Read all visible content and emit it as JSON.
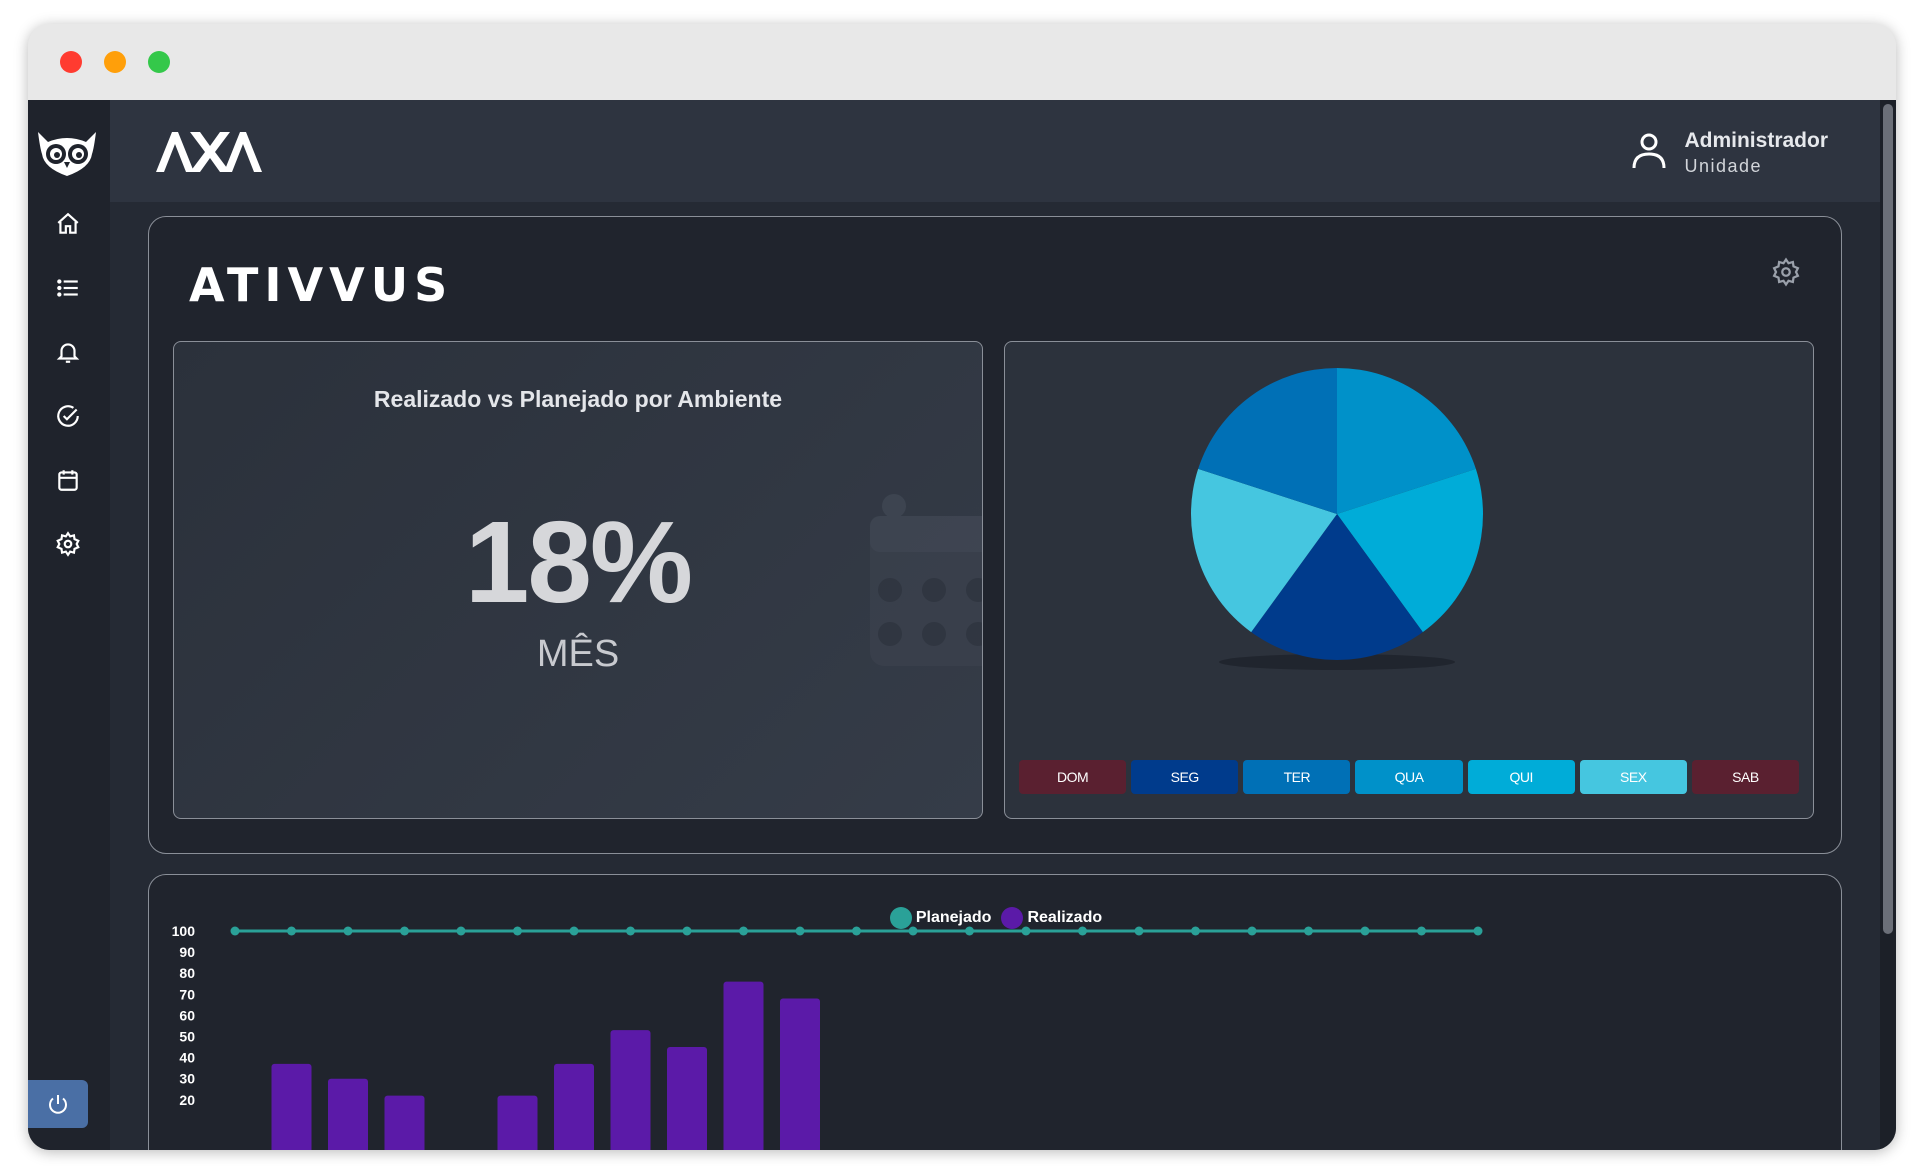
{
  "header": {
    "user_name": "Administrador",
    "user_role": "Unidade"
  },
  "sidebar": {
    "items": [
      {
        "icon": "home-icon"
      },
      {
        "icon": "list-icon"
      },
      {
        "icon": "bell-icon"
      },
      {
        "icon": "check-circle-icon"
      },
      {
        "icon": "calendar-icon"
      },
      {
        "icon": "gear-icon"
      }
    ]
  },
  "panel": {
    "title": "ATIVVUS"
  },
  "kpi": {
    "title": "Realizado vs Planejado por Ambiente",
    "value": "18%",
    "unit": "MÊS"
  },
  "days": [
    {
      "label": "DOM",
      "color": "#5a2030"
    },
    {
      "label": "SEG",
      "color": "#003b8c"
    },
    {
      "label": "TER",
      "color": "#0070b6"
    },
    {
      "label": "QUA",
      "color": "#0091c9"
    },
    {
      "label": "QUI",
      "color": "#00acd8"
    },
    {
      "label": "SEX",
      "color": "#45c6e0"
    },
    {
      "label": "SAB",
      "color": "#5a2030"
    }
  ],
  "chart_data": [
    {
      "type": "pie",
      "slices": [
        {
          "category": "SEG",
          "value": 20,
          "color": "#003b8c"
        },
        {
          "category": "TER",
          "value": 20,
          "color": "#0070b6"
        },
        {
          "category": "QUA",
          "value": 20,
          "color": "#0091c9"
        },
        {
          "category": "QUI",
          "value": 20,
          "color": "#00acd8"
        },
        {
          "category": "SEX",
          "value": 20,
          "color": "#45c6e0"
        }
      ]
    },
    {
      "type": "bar",
      "legend": [
        "Planejado",
        "Realizado"
      ],
      "yticks": [
        100,
        90,
        80,
        70,
        60,
        50,
        40,
        30,
        20
      ],
      "ylim": [
        20,
        100
      ],
      "series": [
        {
          "name": "Planejado",
          "type": "line",
          "color": "#2aa198",
          "values": [
            100,
            100,
            100,
            100,
            100,
            100,
            100,
            100,
            100,
            100,
            100,
            100,
            100,
            100,
            100,
            100,
            100,
            100,
            100,
            100,
            100,
            100,
            100
          ]
        },
        {
          "name": "Realizado",
          "type": "bar",
          "color": "#5b1aa8",
          "values": [
            0,
            37,
            30,
            22,
            0,
            22,
            37,
            53,
            45,
            76,
            68,
            0,
            0,
            0,
            0,
            0,
            0,
            0,
            0,
            0,
            0,
            0,
            0
          ]
        }
      ]
    }
  ]
}
